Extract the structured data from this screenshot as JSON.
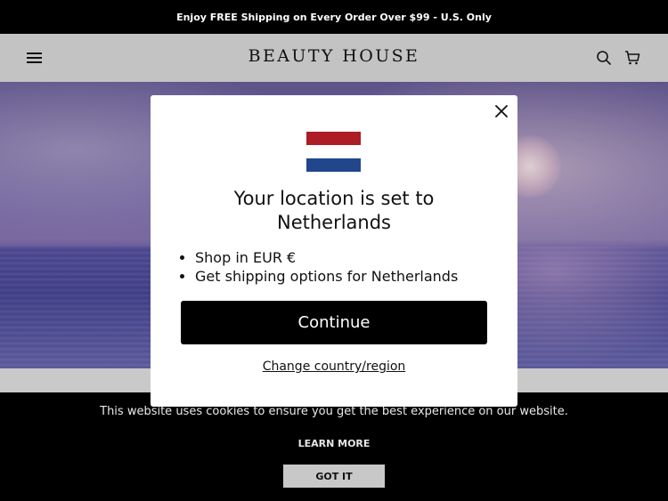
{
  "announcement": {
    "text": "Enjoy FREE Shipping on Every Order Over $99 - U.S. Only"
  },
  "header": {
    "logo": "BEAUTY HOUSE",
    "menu_icon": "hamburger-menu-icon",
    "search_icon": "search-icon",
    "cart_icon": "cart-icon"
  },
  "modal": {
    "flag": "netherlands-flag",
    "flag_colors": {
      "red": "#ad1d25",
      "white": "#ffffff",
      "blue": "#21468b"
    },
    "title_line1": "Your location is set to",
    "title_line2": "Netherlands",
    "bullets": [
      "Shop in EUR €",
      "Get shipping options for Netherlands"
    ],
    "continue_label": "Continue",
    "change_label": "Change country/region",
    "close_icon": "close-icon"
  },
  "cookie_banner": {
    "text": "This website uses cookies to ensure you get the best experience on our website.",
    "learn_more": "LEARN MORE",
    "accept": "GOT IT"
  }
}
